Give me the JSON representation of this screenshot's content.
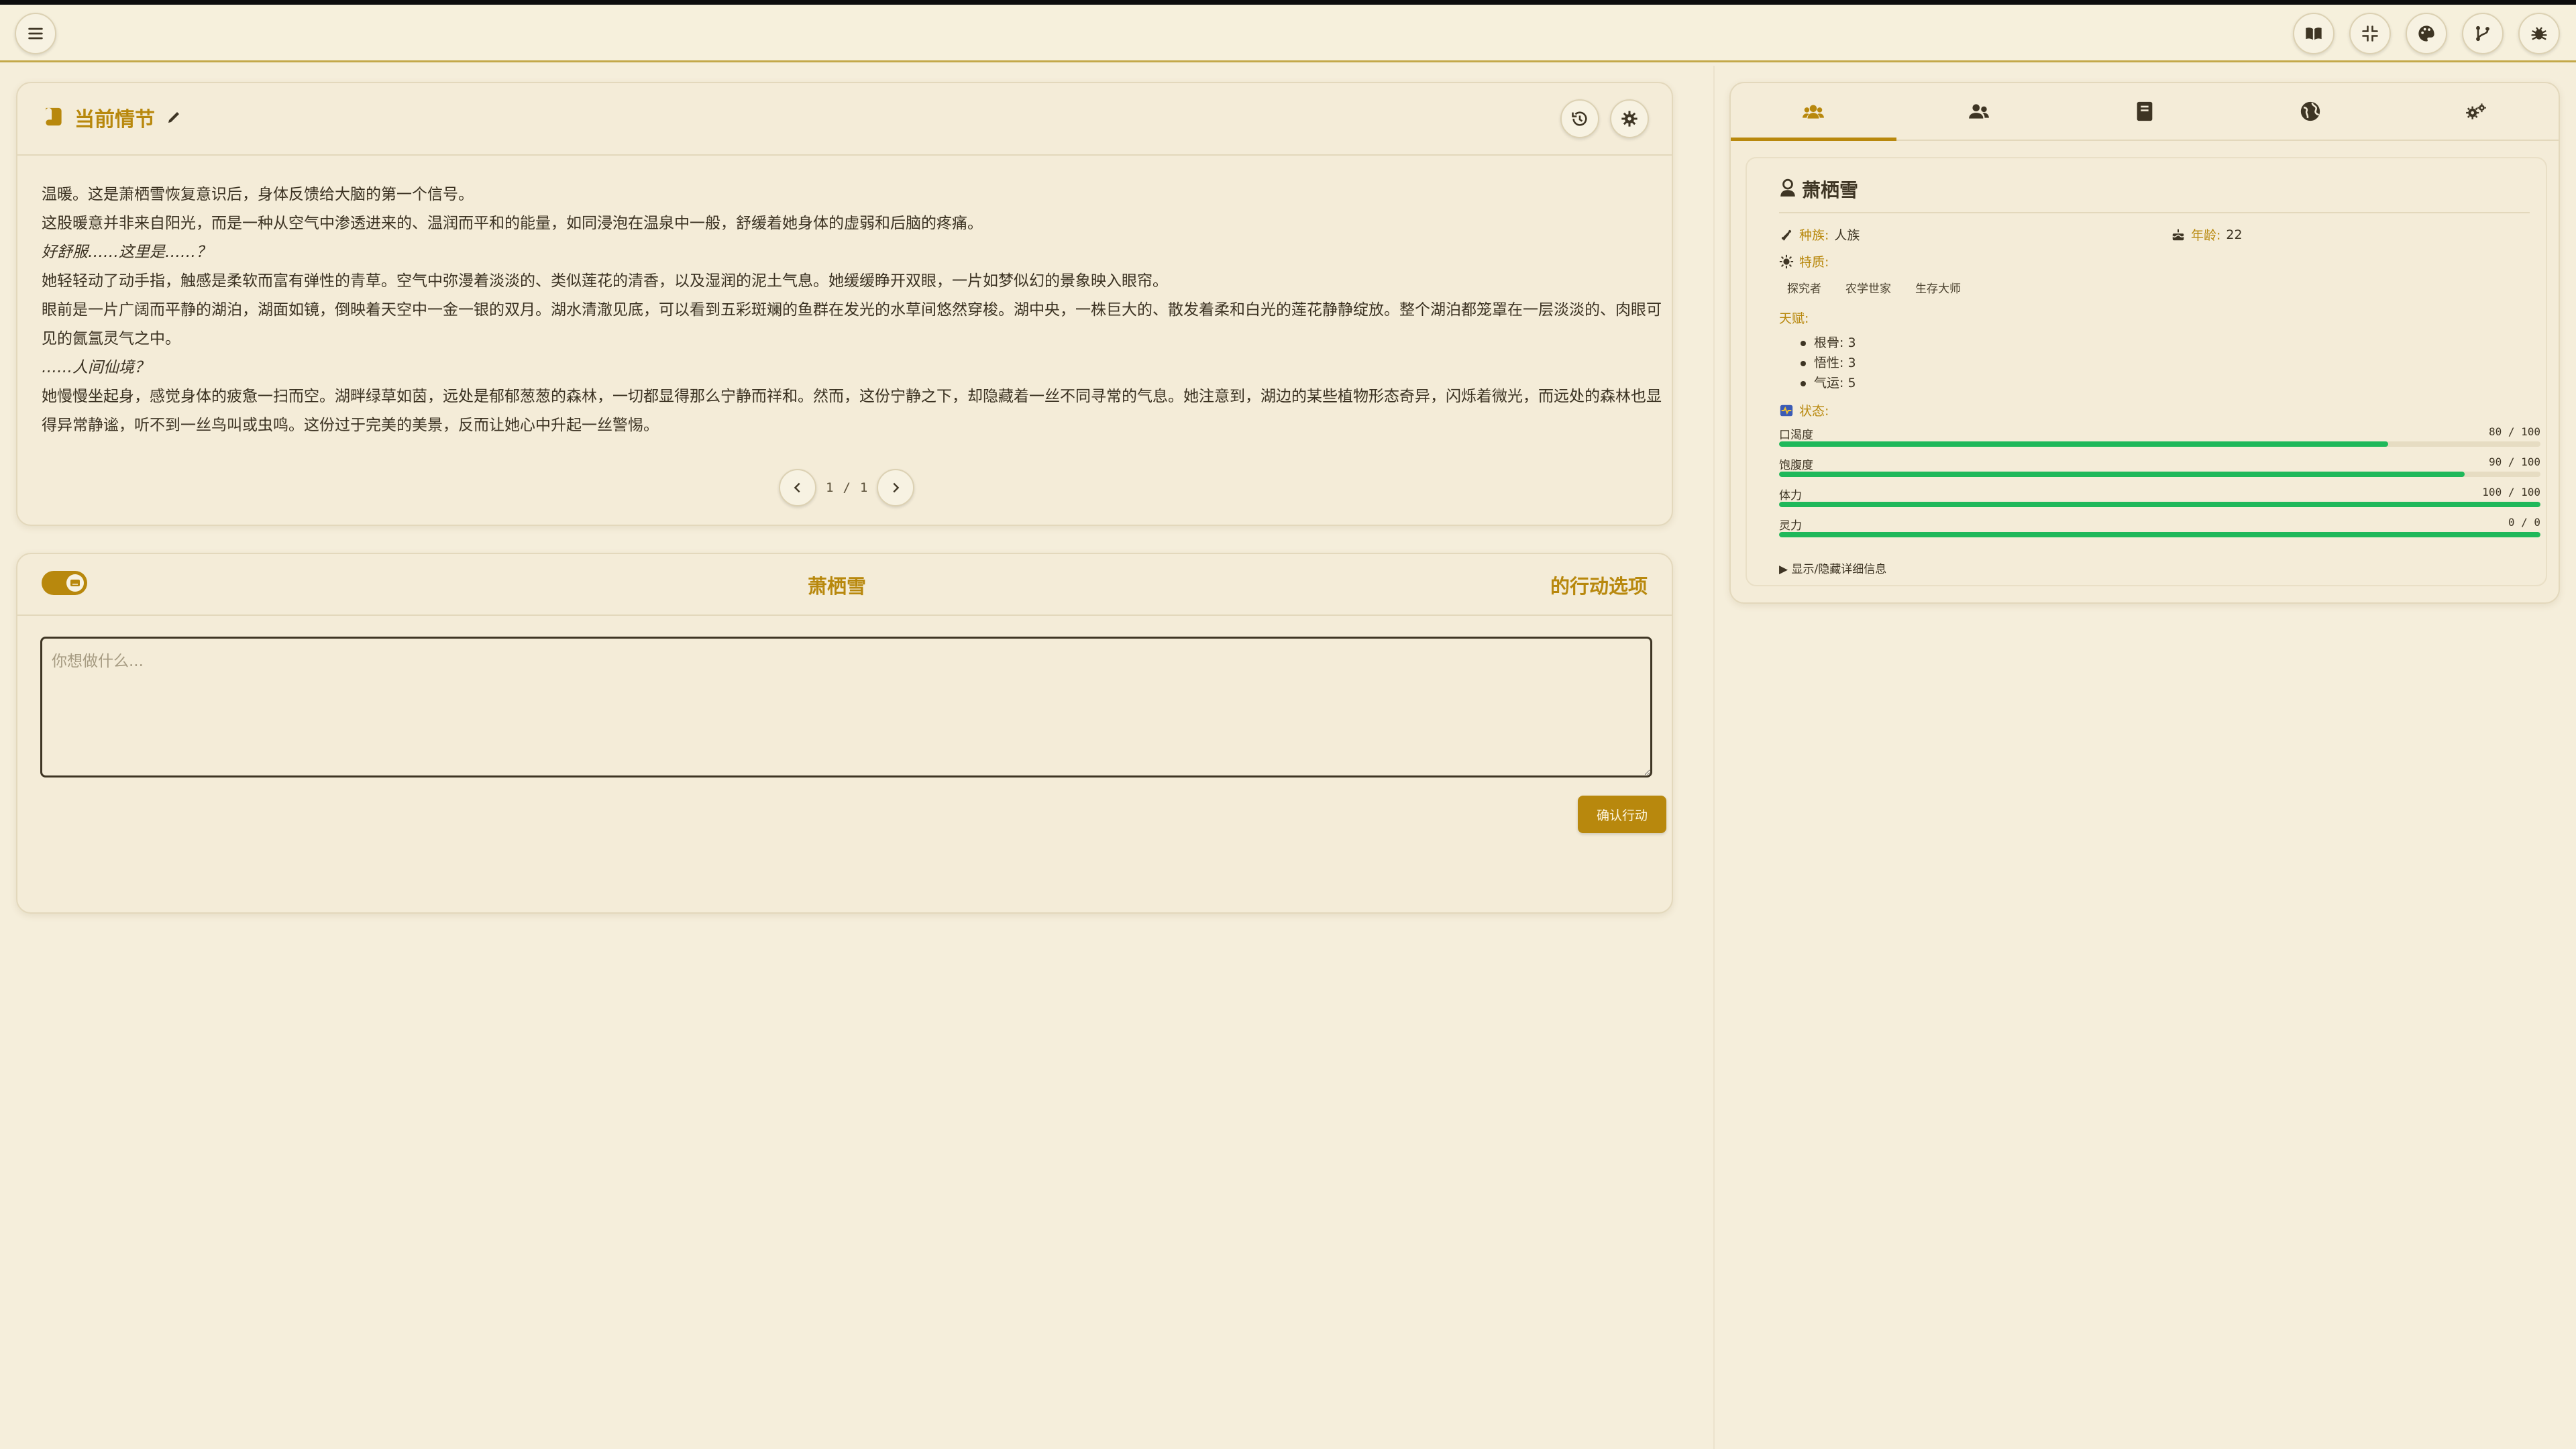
{
  "topbar": {
    "menu_icon": "hamburger-icon",
    "right_icons": [
      "book-icon",
      "compress-icon",
      "palette-icon",
      "branch-icon",
      "bug-icon"
    ]
  },
  "story": {
    "title": "当前情节",
    "paragraphs": [
      {
        "text": "温暖。这是萧栖雪恢复意识后，身体反馈给大脑的第一个信号。",
        "italic": false
      },
      {
        "text": "这股暖意并非来自阳光，而是一种从空气中渗透进来的、温润而平和的能量，如同浸泡在温泉中一般，舒缓着她身体的虚弱和后脑的疼痛。",
        "italic": false
      },
      {
        "text": "好舒服……这里是……？",
        "italic": true
      },
      {
        "text": "她轻轻动了动手指，触感是柔软而富有弹性的青草。空气中弥漫着淡淡的、类似莲花的清香，以及湿润的泥土气息。她缓缓睁开双眼，一片如梦似幻的景象映入眼帘。",
        "italic": false
      },
      {
        "text": "眼前是一片广阔而平静的湖泊，湖面如镜，倒映着天空中一金一银的双月。湖水清澈见底，可以看到五彩斑斓的鱼群在发光的水草间悠然穿梭。湖中央，一株巨大的、散发着柔和白光的莲花静静绽放。整个湖泊都笼罩在一层淡淡的、肉眼可见的氤氲灵气之中。",
        "italic": false
      },
      {
        "text": "……人间仙境？",
        "italic": true
      },
      {
        "text": "她慢慢坐起身，感觉身体的疲惫一扫而空。湖畔绿草如茵，远处是郁郁葱葱的森林，一切都显得那么宁静而祥和。然而，这份宁静之下，却隐藏着一丝不同寻常的气息。她注意到，湖边的某些植物形态奇异，闪烁着微光，而远处的森林也显得异常静谧，听不到一丝鸟叫或虫鸣。这份过于完美的美景，反而让她心中升起一丝警惕。",
        "italic": false
      }
    ],
    "page_current": "1",
    "page_sep": "/",
    "page_total": "1"
  },
  "action": {
    "character_name": "萧栖雪",
    "options_label": "的行动选项",
    "input_placeholder": "你想做什么...",
    "input_value": "",
    "confirm_label": "确认行动"
  },
  "panel": {
    "tabs": [
      {
        "icon": "user-group-icon",
        "active": true
      },
      {
        "icon": "users-icon",
        "active": false
      },
      {
        "icon": "book-icon",
        "active": false
      },
      {
        "icon": "globe-icon",
        "active": false
      },
      {
        "icon": "gears-icon",
        "active": false
      }
    ],
    "character": {
      "name": "萧栖雪",
      "race_label": "种族:",
      "race_value": "人族",
      "age_label": "年龄:",
      "age_value": "22",
      "traits_label": "特质:",
      "traits": [
        "探究者",
        "农学世家",
        "生存大师"
      ],
      "talents_label": "天赋:",
      "talents": [
        "根骨: 3",
        "悟性: 3",
        "气运: 5"
      ],
      "status_label": "状态:",
      "stats": [
        {
          "name": "口渴度",
          "display": "80 / 100",
          "fraction": 0.8
        },
        {
          "name": "饱腹度",
          "display": "90 / 100",
          "fraction": 0.9
        },
        {
          "name": "体力",
          "display": "100 / 100",
          "fraction": 1.0
        },
        {
          "name": "灵力",
          "display": "0 / 0",
          "fraction": 1.0
        }
      ],
      "details_toggle": "▶ 显示/隐藏详细信息"
    }
  },
  "colors": {
    "background": "#f5eedb",
    "accent_gold": "#b8880d",
    "progress_green": "#1fb85a",
    "text_dark": "#3e3524"
  }
}
